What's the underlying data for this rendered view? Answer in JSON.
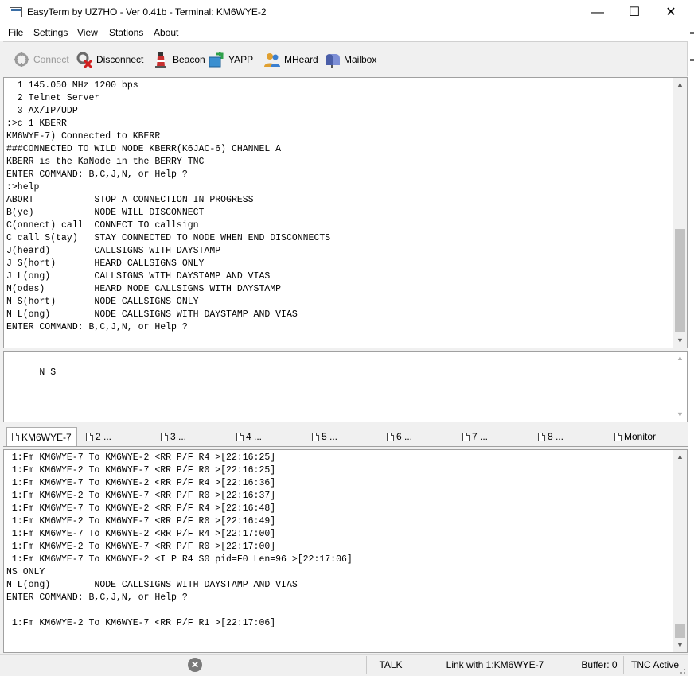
{
  "window": {
    "title": "EasyTerm by UZ7HO - Ver 0.41b - Terminal: KM6WYE-2",
    "minimize_glyph": "—",
    "maximize_glyph": "☐",
    "close_glyph": "✕"
  },
  "menu": [
    "File",
    "Settings",
    "View",
    "Stations",
    "About"
  ],
  "toolbar": {
    "connect": {
      "label": "Connect",
      "icon": "connect-icon",
      "enabled": false
    },
    "disconnect": {
      "label": "Disconnect",
      "icon": "disconnect-icon"
    },
    "beacon": {
      "label": "Beacon",
      "icon": "lighthouse-icon"
    },
    "yapp": {
      "label": "YAPP",
      "icon": "file-transfer-icon"
    },
    "mheard": {
      "label": "MHeard",
      "icon": "people-icon"
    },
    "mailbox": {
      "label": "Mailbox",
      "icon": "mailbox-icon"
    }
  },
  "terminal_lines": [
    "  1 145.050 MHz 1200 bps",
    "  2 Telnet Server",
    "  3 AX/IP/UDP",
    ":>c 1 KBERR",
    "KM6WYE-7) Connected to KBERR",
    "###CONNECTED TO WILD NODE KBERR(K6JAC-6) CHANNEL A",
    "KBERR is the KaNode in the BERRY TNC",
    "ENTER COMMAND: B,C,J,N, or Help ?",
    ":>help",
    "ABORT           STOP A CONNECTION IN PROGRESS",
    "B(ye)           NODE WILL DISCONNECT",
    "C(onnect) call  CONNECT TO callsign",
    "C call S(tay)   STAY CONNECTED TO NODE WHEN END DISCONNECTS",
    "J(heard)        CALLSIGNS WITH DAYSTAMP",
    "J S(hort)       HEARD CALLSIGNS ONLY",
    "J L(ong)        CALLSIGNS WITH DAYSTAMP AND VIAS",
    "N(odes)         HEARD NODE CALLSIGNS WITH DAYSTAMP",
    "N S(hort)       NODE CALLSIGNS ONLY",
    "N L(ong)        NODE CALLSIGNS WITH DAYSTAMP AND VIAS",
    "ENTER COMMAND: B,C,J,N, or Help ?"
  ],
  "input": {
    "value": "N S"
  },
  "tabs": [
    {
      "label": "KM6WYE-7",
      "active": true
    },
    {
      "label": "2 ..."
    },
    {
      "label": "3 ..."
    },
    {
      "label": "4 ..."
    },
    {
      "label": "5 ..."
    },
    {
      "label": "6 ..."
    },
    {
      "label": "7 ..."
    },
    {
      "label": "8 ..."
    },
    {
      "label": "Monitor"
    }
  ],
  "monitor_lines": [
    " 1:Fm KM6WYE-7 To KM6WYE-2 <RR P/F R4 >[22:16:25]",
    " 1:Fm KM6WYE-2 To KM6WYE-7 <RR P/F R0 >[22:16:25]",
    " 1:Fm KM6WYE-7 To KM6WYE-2 <RR P/F R4 >[22:16:36]",
    " 1:Fm KM6WYE-2 To KM6WYE-7 <RR P/F R0 >[22:16:37]",
    " 1:Fm KM6WYE-7 To KM6WYE-2 <RR P/F R4 >[22:16:48]",
    " 1:Fm KM6WYE-2 To KM6WYE-7 <RR P/F R0 >[22:16:49]",
    " 1:Fm KM6WYE-7 To KM6WYE-2 <RR P/F R4 >[22:17:00]",
    " 1:Fm KM6WYE-2 To KM6WYE-7 <RR P/F R0 >[22:17:00]",
    " 1:Fm KM6WYE-7 To KM6WYE-2 <I P R4 S0 pid=F0 Len=96 >[22:17:06]",
    "NS ONLY",
    "N L(ong)        NODE CALLSIGNS WITH DAYSTAMP AND VIAS",
    "ENTER COMMAND: B,C,J,N, or Help ?",
    "",
    " 1:Fm KM6WYE-2 To KM6WYE-7 <RR P/F R1 >[22:17:06]"
  ],
  "status": {
    "cancel_glyph": "✕",
    "mode": "TALK",
    "link": "Link with 1:KM6WYE-7",
    "buffer": "Buffer: 0",
    "tnc": "TNC Active"
  },
  "colors": {
    "accent": "#3a6ea5",
    "scroll_thumb": "#c1c1c1"
  }
}
